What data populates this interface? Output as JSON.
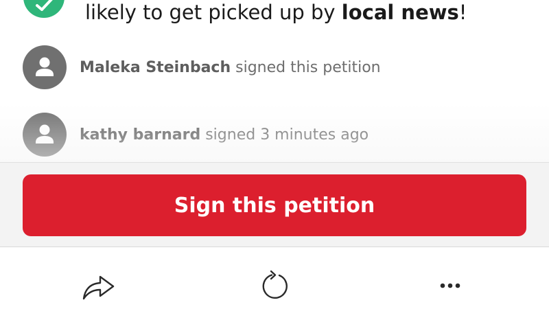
{
  "notice": {
    "text_before": "likely to get picked up by ",
    "text_bold": "local news",
    "text_after": "!",
    "badge_color": "#2fb67a",
    "badge_icon": "check-icon"
  },
  "signers": [
    {
      "name": "Maleka Steinbach",
      "action": "signed this petition",
      "avatar_icon": "person-icon"
    },
    {
      "name": "kathy barnard",
      "action": "signed 3 minutes ago",
      "avatar_icon": "person-icon"
    }
  ],
  "sign_button": {
    "label": "Sign this petition",
    "color": "#dc1f2e"
  },
  "toolbar": {
    "items": [
      {
        "icon": "share-icon"
      },
      {
        "icon": "reload-icon"
      },
      {
        "icon": "more-icon"
      }
    ]
  }
}
